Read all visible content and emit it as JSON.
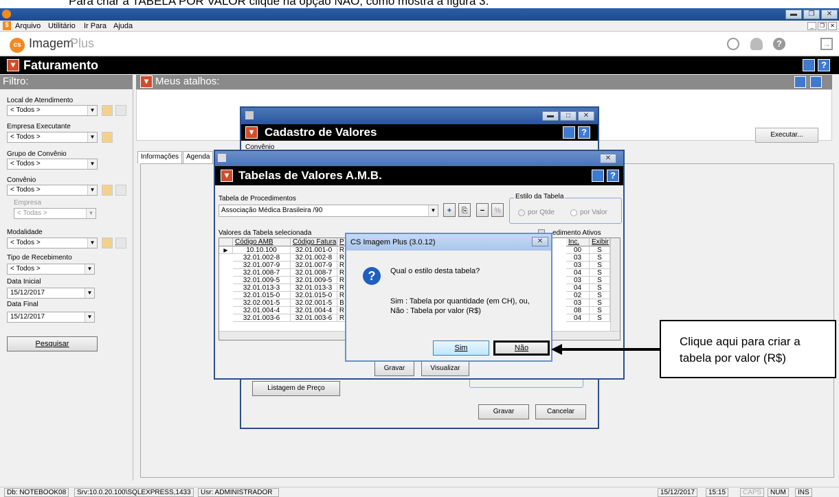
{
  "caption": "Para criar a TABELA POR VALOR clique na opção NÃO, como mostra a figura 3.",
  "menu": [
    "Arquivo",
    "Utilitário",
    "Ir Para",
    "Ajuda"
  ],
  "logo": {
    "brand": "Imagem",
    "suffix": "Plus",
    "mark": "cs"
  },
  "page_header": "Faturamento",
  "filtro": {
    "title": "Filtro:",
    "fields": [
      {
        "label": "Local de Atendimento",
        "value": "< Todos >"
      },
      {
        "label": "Empresa Executante",
        "value": "< Todos >"
      },
      {
        "label": "Grupo de Convênio",
        "value": "< Todos >"
      },
      {
        "label": "Convênio",
        "value": "< Todos >"
      },
      {
        "label": "Empresa",
        "value": "< Todas >"
      },
      {
        "label": "Modalidade",
        "value": "< Todos >"
      },
      {
        "label": "Tipo de Recebimento",
        "value": "< Todos >"
      },
      {
        "label": "Data Inicial",
        "value": "15/12/2017"
      },
      {
        "label": "Data Final",
        "value": "15/12/2017"
      }
    ],
    "search_button": "Pesquisar"
  },
  "atalhos_title": "Meus atalhos:",
  "executar": "Executar...",
  "tabs": [
    "Informações",
    "Agenda"
  ],
  "win_cadastro": {
    "header": "Cadastro de Valores",
    "label": "Convênio",
    "listagem": "Listagem de Preço",
    "gravar": "Gravar",
    "cancelar": "Cancelar"
  },
  "win_tabelas": {
    "header": "Tabelas de Valores A.M.B.",
    "tabela_label": "Tabela de Procedimentos",
    "tabela_value": "Associação Médica Brasileira /90",
    "estilo_label": "Estilo da Tabela",
    "estilo_opt1": "por Qtde",
    "estilo_opt2": "por Valor",
    "valores_label": "Valores da Tabela selecionada",
    "ativos_label": "edimento Ativos",
    "col_amb": "Código AMB",
    "col_fatura": "Código Fatura",
    "col_p": "P",
    "col_inc": "Inc.",
    "col_exibir": "Exibir",
    "rows": [
      {
        "amb": "10.10.100",
        "fat": "32.01.001-0",
        "p": "R",
        "inc": "00",
        "ex": "S"
      },
      {
        "amb": "32.01.002-8",
        "fat": "32.01.002-8",
        "p": "R",
        "inc": "03",
        "ex": "S"
      },
      {
        "amb": "32.01.007-9",
        "fat": "32.01.007-9",
        "p": "R",
        "inc": "03",
        "ex": "S"
      },
      {
        "amb": "32.01.008-7",
        "fat": "32.01.008-7",
        "p": "R",
        "inc": "04",
        "ex": "S"
      },
      {
        "amb": "32.01.009-5",
        "fat": "32.01.009-5",
        "p": "R",
        "inc": "03",
        "ex": "S"
      },
      {
        "amb": "32.01.013-3",
        "fat": "32.01.013-3",
        "p": "R",
        "inc": "04",
        "ex": "S"
      },
      {
        "amb": "32.01.015-0",
        "fat": "32.01.015-0",
        "p": "R",
        "inc": "02",
        "ex": "S"
      },
      {
        "amb": "32.02.001-5",
        "fat": "32.02.001-5",
        "p": "B",
        "inc": "03",
        "ex": "S"
      },
      {
        "amb": "32.01.004-4",
        "fat": "32.01.004-4",
        "p": "R",
        "inc": "08",
        "ex": "S"
      },
      {
        "amb": "32.01.003-6",
        "fat": "32.01.003-6",
        "p": "R",
        "inc": "04",
        "ex": "S"
      }
    ],
    "gravar": "Gravar",
    "visualizar": "Visualizar"
  },
  "dialog": {
    "title": "CS Imagem Plus (3.0.12)",
    "question": "Qual o estilo desta tabela?",
    "line1": "Sim : Tabela por quantidade (em CH), ou,",
    "line2": "Não : Tabela por valor (R$)",
    "sim": "Sim",
    "nao": "Não"
  },
  "callout": "Clique aqui para criar a tabela por valor (R$)",
  "status": {
    "db": "Db: NOTEBOOK08",
    "srv": "Srv:10.0.20.100\\SQLEXPRESS,1433",
    "usr": "Usr: ADMINISTRADOR",
    "date": "15/12/2017",
    "time": "15:15",
    "caps": "CAPS",
    "num": "NUM",
    "ins": "INS"
  }
}
